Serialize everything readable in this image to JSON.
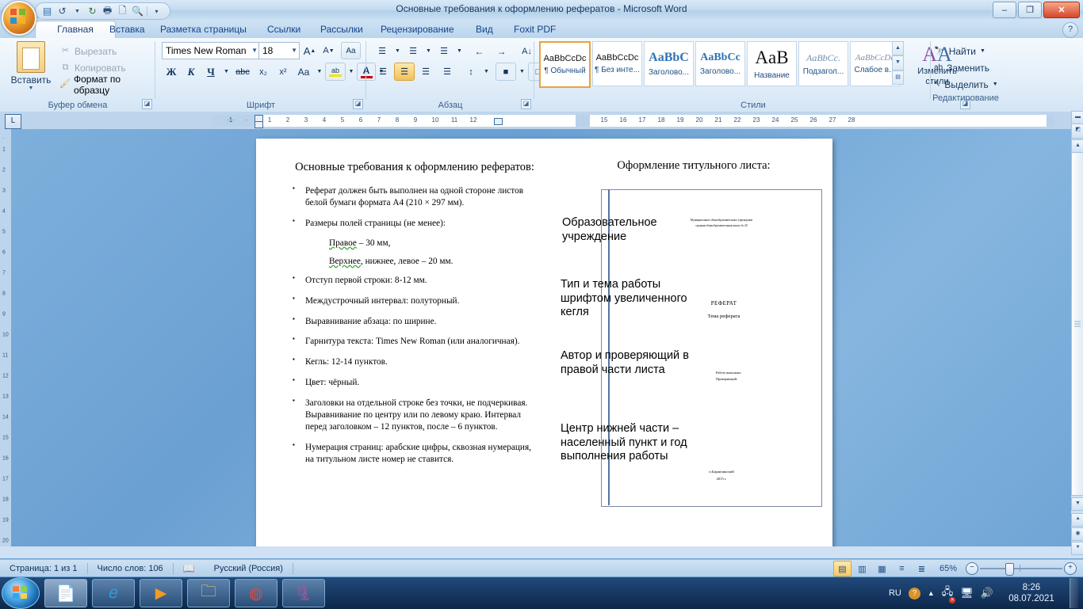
{
  "window": {
    "title": "Основные требования к оформлению рефератов - Microsoft Word",
    "minimize": "–",
    "maximize": "❐",
    "close": "✕",
    "help": "?"
  },
  "quick_access": {
    "save": "💾",
    "undo": "↶",
    "redo": "↻",
    "print": "🖨",
    "new": "🗋",
    "preview": "🔍",
    "customize": "☰"
  },
  "tabs": [
    {
      "label": "Главная",
      "active": true
    },
    {
      "label": "Вставка",
      "active": false
    },
    {
      "label": "Разметка страницы",
      "active": false
    },
    {
      "label": "Ссылки",
      "active": false
    },
    {
      "label": "Рассылки",
      "active": false
    },
    {
      "label": "Рецензирование",
      "active": false
    },
    {
      "label": "Вид",
      "active": false
    },
    {
      "label": "Foxit PDF",
      "active": false
    }
  ],
  "ribbon": {
    "clipboard": {
      "group_label": "Буфер обмена",
      "paste": "Вставить",
      "cut": "Вырезать",
      "copy": "Копировать",
      "format_painter": "Формат по образцу"
    },
    "font": {
      "group_label": "Шрифт",
      "font_name": "Times New Roman",
      "font_size": "18",
      "grow": "A",
      "shrink": "A",
      "clear_format": "Aa",
      "bold": "Ж",
      "italic": "К",
      "underline": "Ч",
      "strikethrough": "abc",
      "subscript": "x₂",
      "superscript": "x²",
      "change_case": "Aa",
      "highlight": "ab",
      "font_color": "A"
    },
    "paragraph": {
      "group_label": "Абзац",
      "bullets": "☰",
      "numbering": "☰",
      "multilevel": "☰",
      "decrease_indent": "←",
      "increase_indent": "→",
      "sort": "A↓",
      "show_marks": "¶",
      "align_left": "☰",
      "align_center": "☰",
      "align_right": "☰",
      "justify": "☰",
      "line_spacing": "↕",
      "shading": "■",
      "borders": "□"
    },
    "styles": {
      "group_label": "Стили",
      "items": [
        {
          "preview": "AaBbCcDc",
          "name": "¶ Обычный",
          "selected": true
        },
        {
          "preview": "AaBbCcDc",
          "name": "¶ Без инте...",
          "selected": false
        },
        {
          "preview": "AaBbC",
          "name": "Заголово...",
          "selected": false
        },
        {
          "preview": "AaBbCc",
          "name": "Заголово...",
          "selected": false
        },
        {
          "preview": "AaB",
          "name": "Название",
          "selected": false
        },
        {
          "preview": "AaBbCc.",
          "name": "Подзагол...",
          "selected": false
        },
        {
          "preview": "AaBbCcDc",
          "name": "Слабое в...",
          "selected": false
        }
      ],
      "change_styles_line1": "Изменить",
      "change_styles_line2": "стили"
    },
    "editing": {
      "group_label": "Редактирование",
      "find": "Найти",
      "replace": "Заменить",
      "select": "Выделить"
    }
  },
  "ruler": {
    "tab_selector": "L",
    "left_labels": [
      "1"
    ],
    "labels": [
      "1",
      "2",
      "3",
      "4",
      "5",
      "6",
      "7",
      "8",
      "9",
      "10",
      "11",
      "12",
      "15",
      "16",
      "17",
      "18",
      "19",
      "20",
      "21",
      "22",
      "23",
      "24",
      "25",
      "26",
      "27",
      "28"
    ],
    "vertical_labels": [
      "1",
      "2",
      "3",
      "4",
      "5",
      "6",
      "7",
      "8",
      "9",
      "10",
      "11",
      "12",
      "13",
      "14",
      "15",
      "16",
      "17",
      "18",
      "19",
      "20"
    ]
  },
  "document": {
    "left_column": {
      "title": "Основные требования к оформлению рефератов:",
      "bullets": [
        "Реферат должен быть выполнен на одной стороне листов белой бумаги формата А4 (210 × 297 мм).",
        "Размеры полей страницы  (не менее):"
      ],
      "sub_items": [
        {
          "spelled": "Правое",
          "rest": " – 30 мм,"
        },
        {
          "spelled": "Верхнее",
          "rest": ", нижнее,  левое – 20 мм."
        }
      ],
      "bullets2": [
        "Отступ первой строки: 8-12 мм.",
        "Междустрочный интервал:  полуторный.",
        "Выравнивание абзаца:  по ширине.",
        "Гарнитура текста:  Times New Roman (или аналогичная).",
        "Кегль: 12-14 пунктов.",
        "Цвет: чёрный.",
        "Заголовки на отдельной строке без точки, не подчеркивая. Выравнивание по центру или по левому краю. Интервал перед заголовком – 12 пунктов, после – 6 пунктов.",
        "Нумерация страниц:  арабские цифры, сквозная нумерация, на титульном листе номер не ставится."
      ]
    },
    "right_column": {
      "title": "Оформление титульного листа:",
      "annotations": [
        "Образовательное учреждение",
        "Тип и тема работы шрифтом увеличенного кегля",
        "Автор и проверяющий в правой части листа",
        "Центр нижней части – населенный пункт и год выполнения работы"
      ],
      "title_page": {
        "org_line1": "Муниципальное общеобразовательное учреждение",
        "org_line2": "средняя общеобразовательная школа № 20",
        "work_type": "РЕФЕРАТ",
        "work_theme": "Тема реферата",
        "author_label": "Работу выполнил:",
        "checker_label": "Проверяющий:",
        "place": "п.Баранчинский",
        "year": "2015 г."
      }
    }
  },
  "status_bar": {
    "page": "Страница: 1 из 1",
    "words": "Число слов: 106",
    "proofing_icon": "✓",
    "language": "Русский (Россия)",
    "views": [
      "▤",
      "▥",
      "▦",
      "≡",
      "≣"
    ],
    "zoom": "65%",
    "zoom_out": "−",
    "zoom_in": "+"
  },
  "taskbar": {
    "start": "start-orb",
    "items": [
      "word-icon",
      "internet-explorer-icon",
      "media-player-icon",
      "explorer-icon",
      "chrome-icon",
      "winrar-icon"
    ],
    "language": "RU",
    "help_icon": "?",
    "time": "8:26",
    "date": "08.07.2021"
  },
  "colors": {
    "accent": "#15428b",
    "titlebar": "#c3dbf0",
    "selection": "#e8a33d"
  }
}
